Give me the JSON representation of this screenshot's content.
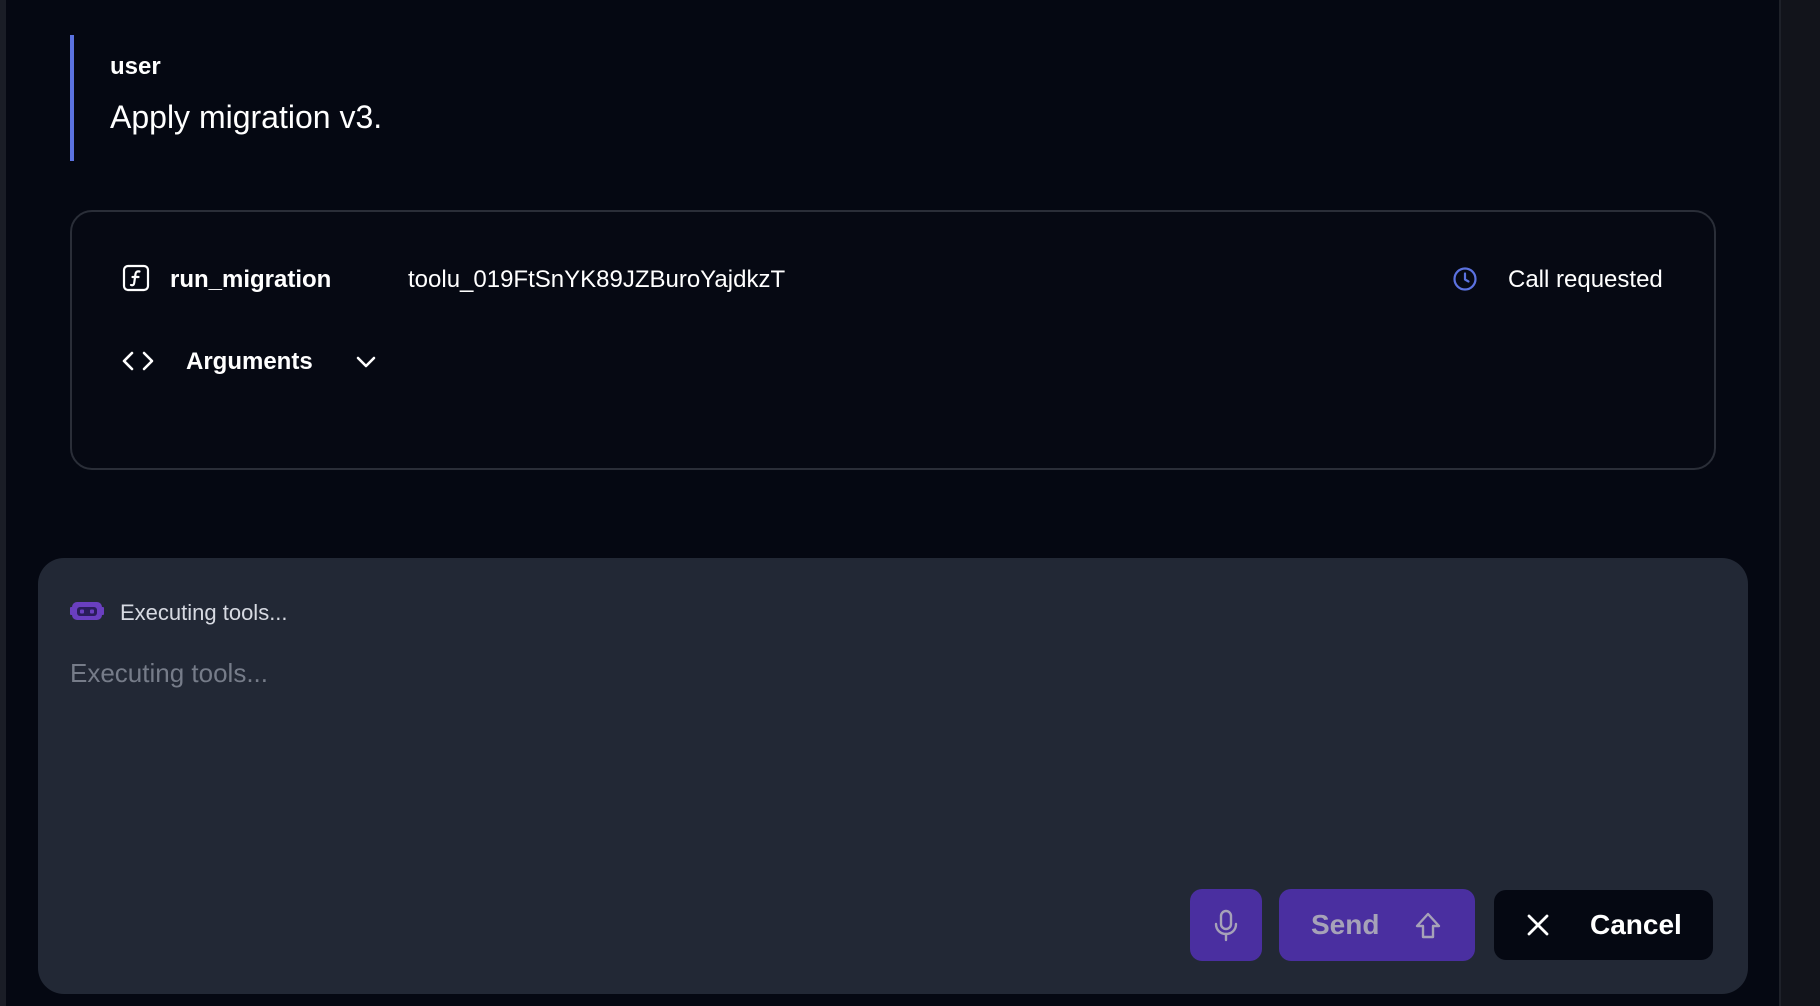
{
  "user_message": {
    "role": "user",
    "text": "Apply migration v3."
  },
  "tool_call": {
    "icon": "function-icon",
    "name": "run_migration",
    "id": "toolu_019FtSnYK89JZBuroYajdkzT",
    "status_icon": "clock-icon",
    "status": "Call requested",
    "arguments_label": "Arguments"
  },
  "composer": {
    "status_icon": "bot-icon",
    "status_text": "Executing tools...",
    "placeholder": "Executing tools...",
    "send_label": "Send",
    "cancel_label": "Cancel"
  },
  "colors": {
    "background": "#050812",
    "accent_bar": "#5b72e0",
    "composer_bg": "#222835",
    "button_purple": "#4a2fa0",
    "clock_blue": "#5b72e0",
    "bot_purple": "#6a3fc0"
  }
}
